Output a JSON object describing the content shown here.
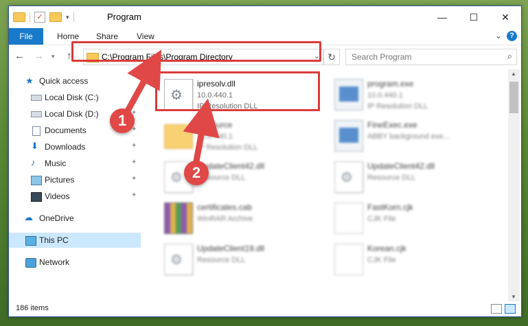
{
  "window": {
    "title": "Program"
  },
  "ribbon": {
    "file": "File",
    "home": "Home",
    "share": "Share",
    "view": "View"
  },
  "address": {
    "path": "C:\\Program Files\\Program Directory"
  },
  "search": {
    "placeholder": "Search Program"
  },
  "sidebar": {
    "items": [
      {
        "label": "Quick access",
        "icon": "star-icon"
      },
      {
        "label": "Local Disk (C:)",
        "icon": "drive-icon"
      },
      {
        "label": "Local Disk (D:)",
        "icon": "drive-icon"
      },
      {
        "label": "Documents",
        "icon": "documents-icon"
      },
      {
        "label": "Downloads",
        "icon": "downloads-icon"
      },
      {
        "label": "Music",
        "icon": "music-icon"
      },
      {
        "label": "Pictures",
        "icon": "pictures-icon"
      },
      {
        "label": "Videos",
        "icon": "videos-icon"
      },
      {
        "label": "OneDrive",
        "icon": "onedrive-icon"
      },
      {
        "label": "This PC",
        "icon": "pc-icon"
      },
      {
        "label": "Network",
        "icon": "network-icon"
      }
    ]
  },
  "files": [
    {
      "name": "ipresolv.dll",
      "line2": "10.0.440.1",
      "line3": "IP Resolution DLL",
      "type": "dll"
    },
    {
      "name": "program.exe",
      "line2": "10.0.440.1",
      "line3": "IP Resolution DLL",
      "type": "exe"
    },
    {
      "name": "Resource",
      "line2": "10.0.440.1",
      "line3": "IP Resolution DLL",
      "type": "folder"
    },
    {
      "name": "FineExec.exe",
      "line2": "ABBY background exe...",
      "line3": "",
      "type": "exe"
    },
    {
      "name": "UpdateClient42.dll",
      "line2": "Resource DLL",
      "line3": "",
      "type": "dll"
    },
    {
      "name": "UpdateClient42.dll",
      "line2": "Resource DLL",
      "line3": "",
      "type": "dll"
    },
    {
      "name": "certificates.cab",
      "line2": "WinRAR Archive",
      "line3": "",
      "type": "cab"
    },
    {
      "name": "FastKorn.cjk",
      "line2": "CJK File",
      "line3": "",
      "type": "cjk"
    },
    {
      "name": "UpdateClient19.dll",
      "line2": "Resource DLL",
      "line3": "",
      "type": "dll"
    },
    {
      "name": "Korean.cjk",
      "line2": "CJK File",
      "line3": "",
      "type": "cjk"
    }
  ],
  "status": {
    "items": "186 items"
  },
  "callouts": {
    "one": "1",
    "two": "2"
  },
  "colors": {
    "accent": "#1979ca",
    "highlight": "#d93b3b",
    "selected": "#cce8ff"
  }
}
